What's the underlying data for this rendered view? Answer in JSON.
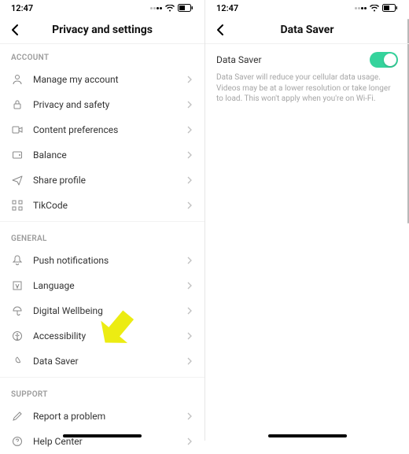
{
  "status": {
    "time": "12:47"
  },
  "left": {
    "title": "Privacy and settings",
    "sections": {
      "account": {
        "label": "ACCOUNT",
        "items": [
          {
            "label": "Manage my account"
          },
          {
            "label": "Privacy and safety"
          },
          {
            "label": "Content preferences"
          },
          {
            "label": "Balance"
          },
          {
            "label": "Share profile"
          },
          {
            "label": "TikCode"
          }
        ]
      },
      "general": {
        "label": "GENERAL",
        "items": [
          {
            "label": "Push notifications"
          },
          {
            "label": "Language"
          },
          {
            "label": "Digital Wellbeing"
          },
          {
            "label": "Accessibility"
          },
          {
            "label": "Data Saver"
          }
        ]
      },
      "support": {
        "label": "SUPPORT",
        "items": [
          {
            "label": "Report a problem"
          },
          {
            "label": "Help Center"
          }
        ]
      }
    }
  },
  "right": {
    "title": "Data Saver",
    "ds": {
      "label": "Data Saver",
      "desc": "Data Saver will reduce your cellular data usage. Videos may be at a lower resolution or take longer to load. This won't apply when you're on Wi-Fi.",
      "enabled": true
    }
  },
  "colors": {
    "accent": "#35d39c",
    "annotation": "#ecec12"
  }
}
